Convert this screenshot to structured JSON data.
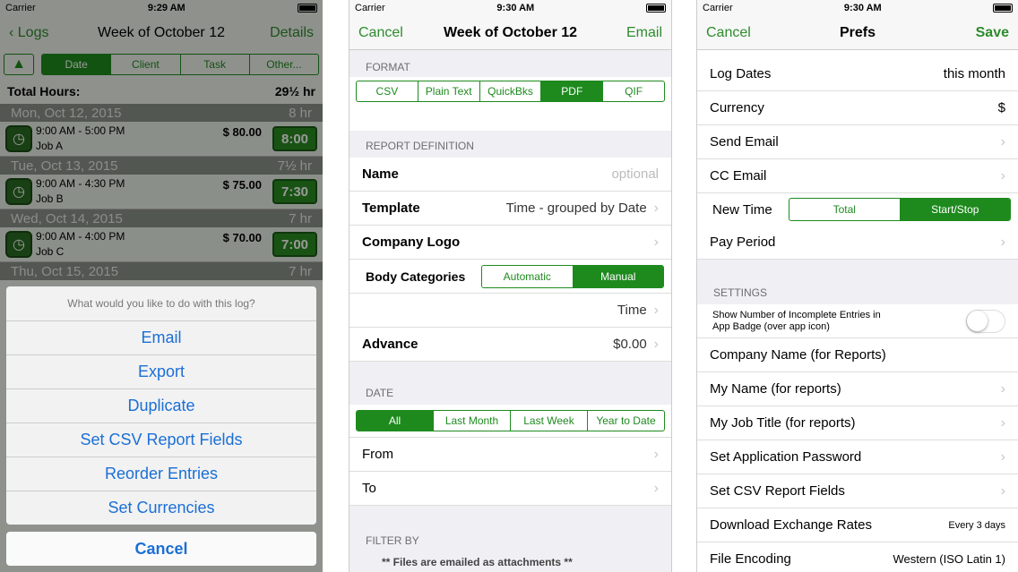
{
  "p1": {
    "status": {
      "carrier": "Carrier",
      "time": "9:29 AM"
    },
    "nav": {
      "back": "Logs",
      "title": "Week of October 12",
      "right": "Details"
    },
    "tabs": [
      "Date",
      "Client",
      "Task",
      "Other..."
    ],
    "total_label": "Total Hours:",
    "total_value": "29½ hr",
    "days": [
      {
        "day": "Mon, Oct 12, 2015",
        "hours": "8 hr",
        "time": "9:00 AM - 5:00 PM",
        "job": "Job A",
        "amount": "$ 80.00",
        "dur": "8:00"
      },
      {
        "day": "Tue, Oct 13, 2015",
        "hours": "7½ hr",
        "time": "9:00 AM - 4:30 PM",
        "job": "Job B",
        "amount": "$ 75.00",
        "dur": "7:30"
      },
      {
        "day": "Wed, Oct 14, 2015",
        "hours": "7 hr",
        "time": "9:00 AM - 4:00 PM",
        "job": "Job C",
        "amount": "$ 70.00",
        "dur": "7:00"
      },
      {
        "day": "Thu, Oct 15, 2015",
        "hours": "7 hr"
      }
    ],
    "sheet": {
      "question": "What would you like to do with this log?",
      "actions": [
        "Email",
        "Export",
        "Duplicate",
        "Set CSV Report Fields",
        "Reorder Entries",
        "Set Currencies"
      ],
      "cancel": "Cancel"
    }
  },
  "p2": {
    "status": {
      "carrier": "Carrier",
      "time": "9:30 AM"
    },
    "nav": {
      "left": "Cancel",
      "title": "Week of October 12",
      "right": "Email"
    },
    "format_header": "FORMAT",
    "formats": [
      "CSV",
      "Plain Text",
      "QuickBks",
      "PDF",
      "QIF"
    ],
    "format_selected": 3,
    "report_header": "REPORT DEFINITION",
    "name_label": "Name",
    "name_placeholder": "optional",
    "template_label": "Template",
    "template_value": "Time - grouped by Date",
    "logo_label": "Company Logo",
    "body_label": "Body Categories",
    "body_options": [
      "Automatic",
      "Manual"
    ],
    "time_value": "Time",
    "advance_label": "Advance",
    "advance_value": "$0.00",
    "date_header": "DATE",
    "date_options": [
      "All",
      "Last Month",
      "Last Week",
      "Year to Date"
    ],
    "from_label": "From",
    "to_label": "To",
    "filter_header": "FILTER BY",
    "note": "** Files are emailed as attachments **"
  },
  "p3": {
    "status": {
      "carrier": "Carrier",
      "time": "9:30 AM"
    },
    "nav": {
      "left": "Cancel",
      "title": "Prefs",
      "right": "Save"
    },
    "log_dates": "Log Dates",
    "log_dates_value": "this month",
    "currency": "Currency",
    "currency_value": "$",
    "send_email": "Send Email",
    "cc_email": "CC Email",
    "new_time": "New Time",
    "new_time_options": [
      "Total",
      "Start/Stop"
    ],
    "pay_period": "Pay Period",
    "settings_header": "SETTINGS",
    "incomplete": "Show Number of Incomplete Entries in App Badge (over app icon)",
    "company_name": "Company Name (for Reports)",
    "my_name": "My Name (for reports)",
    "my_title": "My Job Title (for reports)",
    "app_password": "Set Application Password",
    "csv_fields": "Set CSV Report Fields",
    "exchange": "Download Exchange Rates",
    "exchange_value": "Every 3 days",
    "encoding": "File Encoding",
    "encoding_value": "Western (ISO Latin 1)"
  }
}
